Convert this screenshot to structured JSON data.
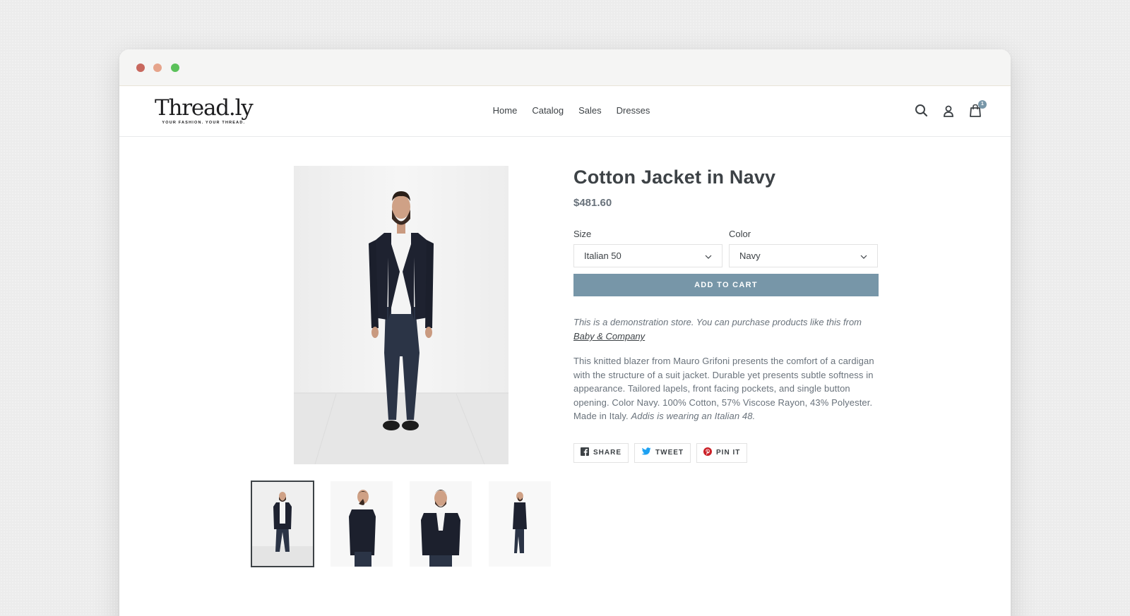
{
  "store": {
    "logo_text": "Thread.ly",
    "logo_tagline": "YOUR FASHION. YOUR THREAD."
  },
  "nav": {
    "items": [
      {
        "label": "Home"
      },
      {
        "label": "Catalog"
      },
      {
        "label": "Sales"
      },
      {
        "label": "Dresses"
      }
    ]
  },
  "header_icons": {
    "search": "search-icon",
    "account": "user-icon",
    "cart": "cart-icon",
    "cart_count": "1"
  },
  "product": {
    "title": "Cotton Jacket in Navy",
    "price": "$481.60",
    "size_label": "Size",
    "size_value": "Italian 50",
    "color_label": "Color",
    "color_value": "Navy",
    "add_to_cart_label": "ADD TO CART",
    "demo_note_prefix": "This is a demonstration store. You can purchase products like this from",
    "demo_note_link": "Baby & Company",
    "description": "This knitted blazer from Mauro Grifoni presents the comfort of a cardigan with the structure of a suit jacket. Durable yet presents subtle softness in appearance. Tailored lapels, front facing pockets, and single button opening. Color Navy. 100% Cotton, 57% Viscose Rayon, 43% Polyester. Made in Italy.",
    "description_italic": "Addis is wearing an Italian 48."
  },
  "share": {
    "facebook_label": "SHARE",
    "twitter_label": "TWEET",
    "pinterest_label": "PIN IT"
  },
  "colors": {
    "accent": "#7796a8",
    "text": "#3d4246",
    "muted": "#69727b"
  }
}
